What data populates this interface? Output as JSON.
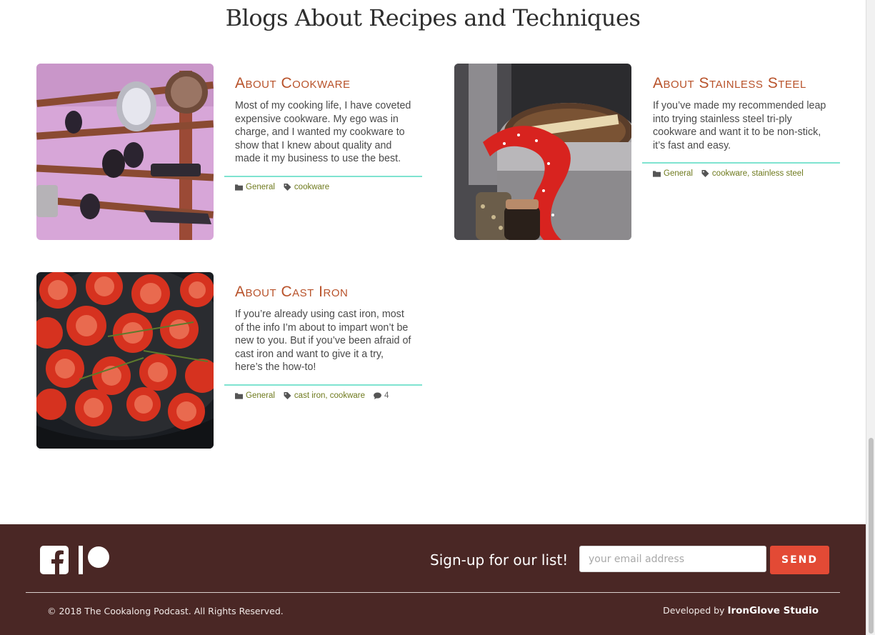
{
  "section": {
    "title": "Blogs About Recipes and Techniques"
  },
  "posts": [
    {
      "title": "About Cookware",
      "excerpt": "Most of my cooking life, I have coveted expensive cookware. My ego was in charge, and I wanted my cookware to show that I knew about quality and made it my business to use the best.",
      "category": "General",
      "tags": "cookware",
      "image": "hanging-utensils-photo"
    },
    {
      "title": "About Stainless Steel",
      "excerpt": "If you’ve made my recommended leap into trying stainless steel tri-ply cookware and want it to be non-stick, it’s fast and easy.",
      "category": "General",
      "tags": "cookware, stainless steel",
      "image": "stainless-pot-ribbon-photo"
    },
    {
      "title": "About Cast Iron",
      "excerpt": "If you’re already using cast iron, most of the info I’m about to impart won’t be new to you. But if you’ve been afraid of cast iron and want to give it a try, here’s the how-to!",
      "category": "General",
      "tags": "cast iron, cookware",
      "comments": "4",
      "image": "tomatoes-cast-iron-photo"
    }
  ],
  "footer": {
    "signup_text": "Sign-up for our list!",
    "email_placeholder": "your email address",
    "send_label": "SEND",
    "copyright": "© 2018 The Cookalong Podcast. All Rights Reserved.",
    "developed_by": "Developed by",
    "developer": "IronGlove Studio",
    "social_icons": [
      "facebook-icon",
      "patreon-icon"
    ]
  },
  "colors": {
    "title_accent": "#b8522a",
    "tag_link": "#6f7a1e",
    "rule": "#7fe3d0",
    "footer_bg": "#4a2725",
    "send_button": "#e34a35"
  }
}
